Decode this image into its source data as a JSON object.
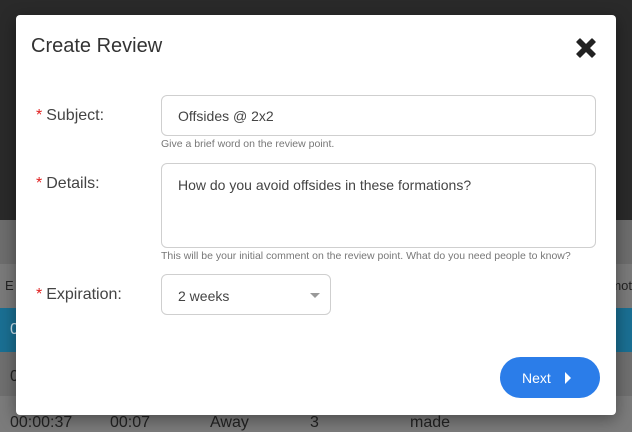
{
  "background": {
    "header_left": "E",
    "header_right": "mot",
    "blue_row_text": "0",
    "row1_first_cell": "0",
    "row2": [
      "00:00:37",
      "00:07",
      "Away",
      "3",
      "made"
    ]
  },
  "modal": {
    "title": "Create Review",
    "close_icon": "close-icon",
    "required_marker": "*",
    "subject": {
      "label": "Subject:",
      "value": "Offsides @ 2x2",
      "help": "Give a brief word on the review point."
    },
    "details": {
      "label": "Details:",
      "value": "How do you avoid offsides in these formations?",
      "help": "This will be your initial comment on the review point. What do you need people to know?"
    },
    "expiration": {
      "label": "Expiration:",
      "selected": "2 weeks"
    },
    "next_button": {
      "label": "Next",
      "icon": "caret-right-icon"
    }
  },
  "colors": {
    "accent": "#2b7de9",
    "required": "#e02020",
    "table_highlight": "#1a6f93"
  }
}
